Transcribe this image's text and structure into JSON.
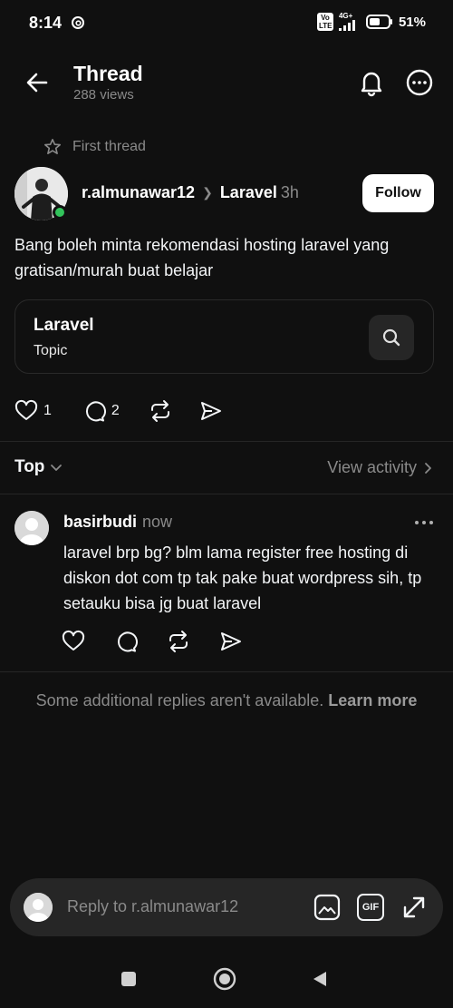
{
  "status_bar": {
    "time": "8:14",
    "volte_label": "Vo LTE",
    "network": "4G+",
    "battery": "51%"
  },
  "header": {
    "title": "Thread",
    "views": "288 views"
  },
  "thread_label": "First thread",
  "post": {
    "author": "r.almunawar12",
    "topic": "Laravel",
    "time": "3h",
    "follow_label": "Follow",
    "text": "Bang boleh minta rekomendasi hosting laravel yang gratisan/murah buat belajar",
    "likes": "1",
    "comments": "2"
  },
  "topic_card": {
    "title": "Laravel",
    "subtitle": "Topic"
  },
  "sort": {
    "label": "Top",
    "view_activity": "View activity"
  },
  "reply": {
    "user": "basirbudi",
    "time": "now",
    "text": "laravel brp bg? blm lama register free hosting di diskon dot com tp tak pake buat wordpress sih, tp setauku bisa jg buat laravel"
  },
  "unavailable": {
    "text": "Some additional replies aren't available.",
    "link": "Learn more"
  },
  "composer": {
    "placeholder": "Reply to r.almunawar12",
    "gif_label": "GIF"
  },
  "colors": {
    "background": "#101010",
    "online": "#32c35b",
    "muted": "#8a8a8a"
  }
}
